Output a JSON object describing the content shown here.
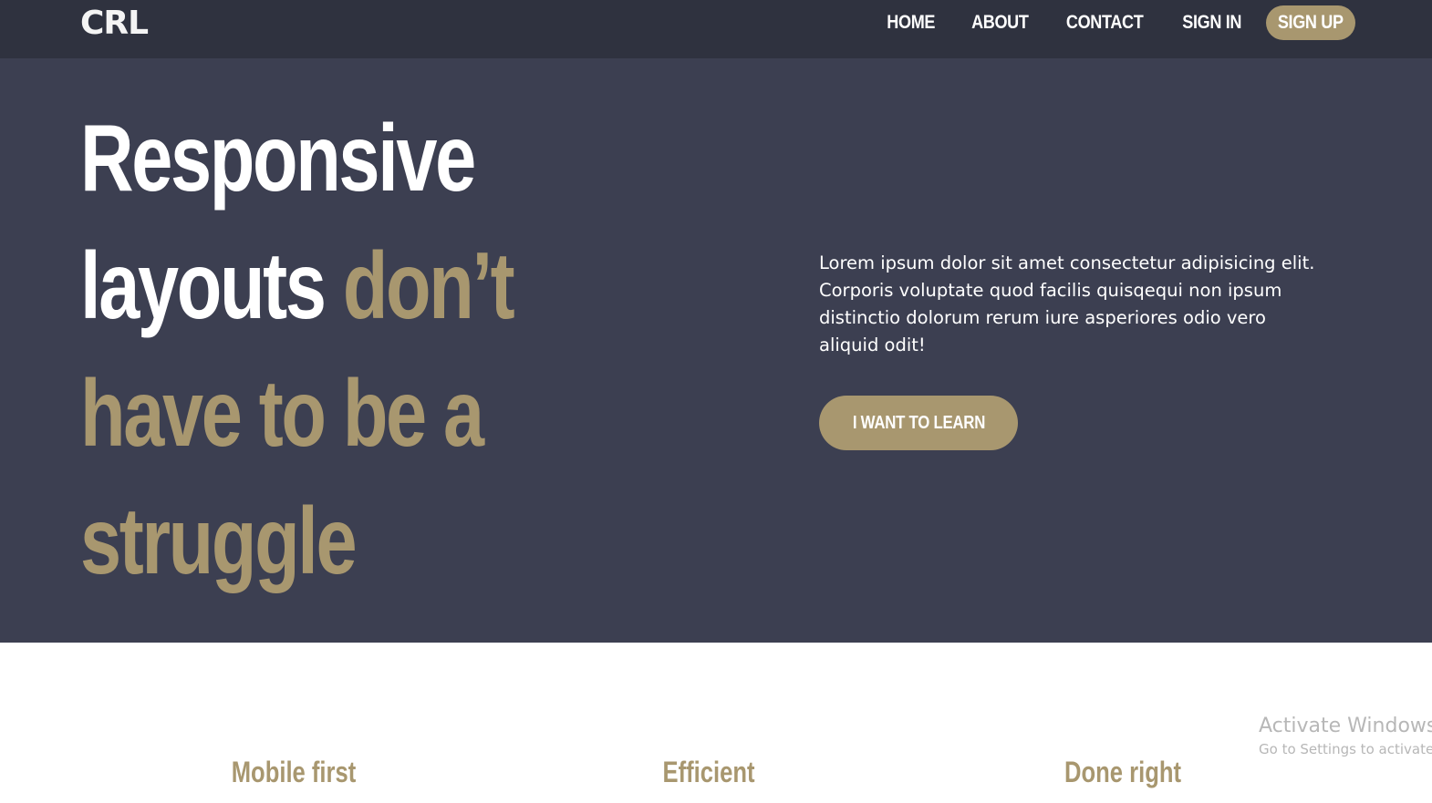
{
  "nav": {
    "logo": "CRL",
    "links": [
      "HOME",
      "ABOUT",
      "CONTACT",
      "SIGN IN"
    ],
    "cta": "SIGN UP"
  },
  "hero": {
    "headline": {
      "line1": "Responsive",
      "line2_white": "layouts",
      "line2_accent": "don’t",
      "line3": "have to be a",
      "line4": "struggle"
    },
    "body": "Lorem ipsum dolor sit amet consectetur adipisicing elit. Corporis voluptate quod facilis quisqequi non ipsum distinctio dolorum rerum iure asperiores odio vero aliquid odit!",
    "button": "I WANT TO LEARN"
  },
  "features": [
    {
      "title": "Mobile first"
    },
    {
      "title": "Efficient"
    },
    {
      "title": "Done right"
    }
  ],
  "watermark": {
    "title": "Activate Windows",
    "subtitle": "Go to Settings to activate Windows."
  },
  "colors": {
    "nav_bg": "#2f323f",
    "hero_bg": "#3c3f51",
    "accent": "#a8976f",
    "text_light": "#ffffff"
  }
}
